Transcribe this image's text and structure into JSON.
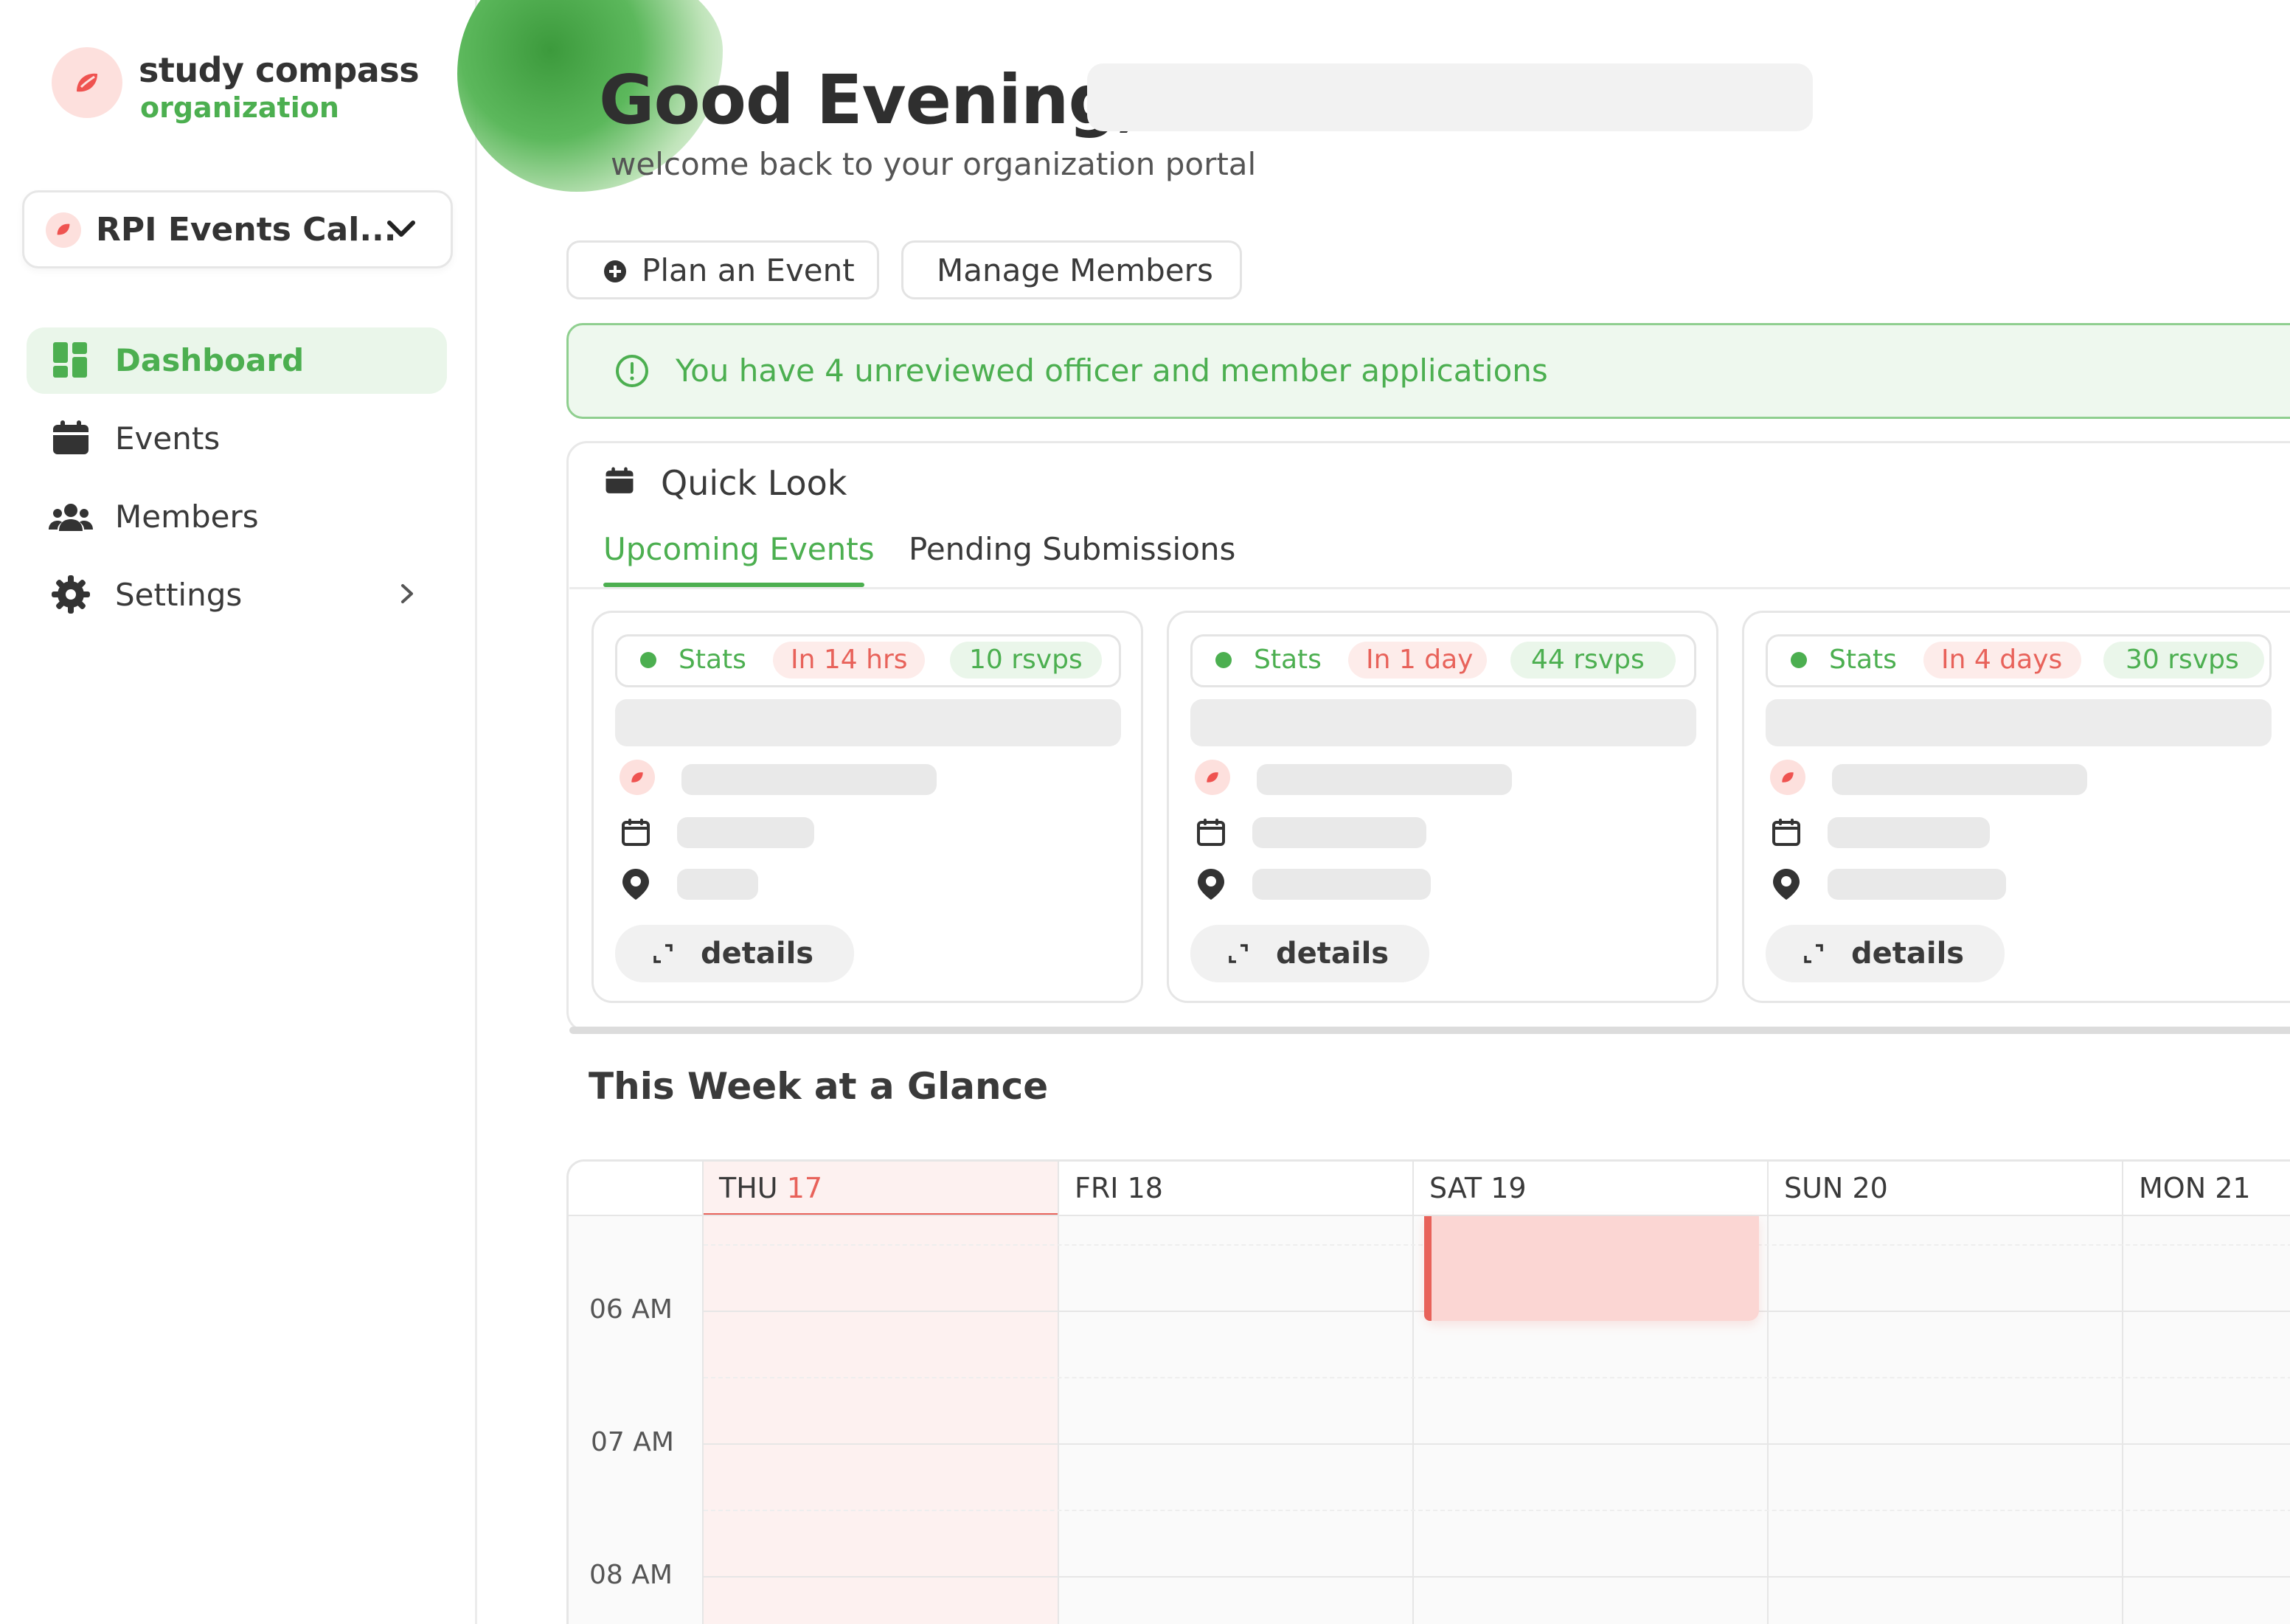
{
  "brand": {
    "name": "study compass",
    "sub": "organization"
  },
  "org_select": {
    "name": "RPI Events Cal..."
  },
  "nav": [
    {
      "label": "Dashboard"
    },
    {
      "label": "Events"
    },
    {
      "label": "Members"
    },
    {
      "label": "Settings"
    }
  ],
  "header": {
    "greeting": "Good Evening,",
    "subtitle": "welcome back to your organization portal"
  },
  "actions": {
    "plan": "Plan an Event",
    "manage": "Manage Members"
  },
  "alert": {
    "text": "You have 4 unreviewed officer and member applications"
  },
  "quick_look": {
    "title": "Quick Look",
    "tabs": [
      "Upcoming Events",
      "Pending Submissions"
    ],
    "cards": [
      {
        "stats": "Stats",
        "time": "In 14 hrs",
        "rsvps": "10 rsvps",
        "details": "details"
      },
      {
        "stats": "Stats",
        "time": "In 1 day",
        "rsvps": "44 rsvps",
        "details": "details"
      },
      {
        "stats": "Stats",
        "time": "In 4 days",
        "rsvps": "30 rsvps",
        "details": "details"
      }
    ]
  },
  "week": {
    "title": "This Week at a Glance",
    "days": [
      {
        "dow": "THU",
        "num": "17"
      },
      {
        "dow": "FRI",
        "num": "18"
      },
      {
        "dow": "SAT",
        "num": "19"
      },
      {
        "dow": "SUN",
        "num": "20"
      },
      {
        "dow": "MON",
        "num": "21"
      }
    ],
    "times": [
      "06 AM",
      "07 AM",
      "08 AM"
    ]
  },
  "colors": {
    "accent": "#4caf50",
    "danger": "#e8625a",
    "event_block": "#fbd6d3"
  }
}
